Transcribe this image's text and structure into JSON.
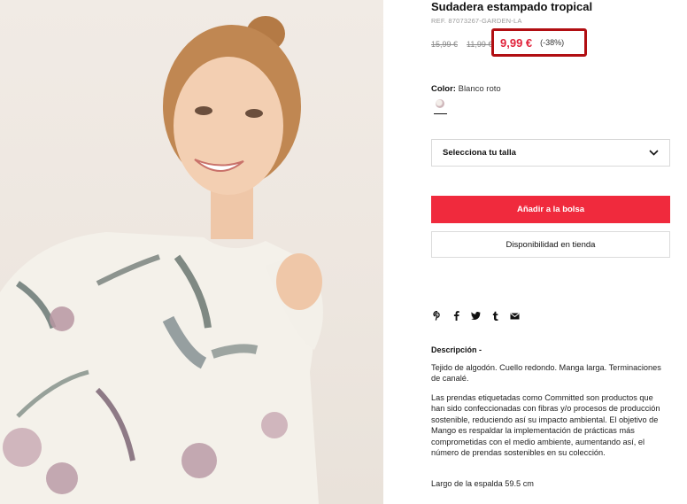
{
  "product": {
    "title": "Sudadera estampado tropical",
    "ref": "REF. 87073267-GARDEN-LA",
    "original_price": "15,99 €",
    "previous_price": "11,99 €",
    "current_price": "9,99 €",
    "discount": "(-38%)"
  },
  "color": {
    "label": "Color:",
    "value": "Blanco roto"
  },
  "size_select": {
    "label": "Selecciona tu talla",
    "icon": "chevron-down-icon"
  },
  "buttons": {
    "add_to_bag": "Añadir a la bolsa",
    "store_availability": "Disponibilidad en tienda"
  },
  "share_icons": [
    "pinterest-icon",
    "facebook-icon",
    "twitter-icon",
    "tumblr-icon",
    "email-icon"
  ],
  "description": {
    "title": "Descripción -",
    "p1": "Tejido de algodón. Cuello redondo. Manga larga. Terminaciones de canalé.",
    "p2": "Las prendas etiquetadas como Committed son productos que han sido confeccionadas con fibras y/o procesos de producción sostenible, reduciendo así su impacto ambiental. El objetivo de Mango es respaldar la implementación de prácticas más comprometidas con el medio ambiente, aumentando así, el número de prendas sostenibles en su colección.",
    "p3": "Largo de la espalda 59.5 cm"
  },
  "colors": {
    "accent_red": "#f02a3d",
    "price_red": "#e1243c",
    "highlight_border": "#b10e12"
  }
}
